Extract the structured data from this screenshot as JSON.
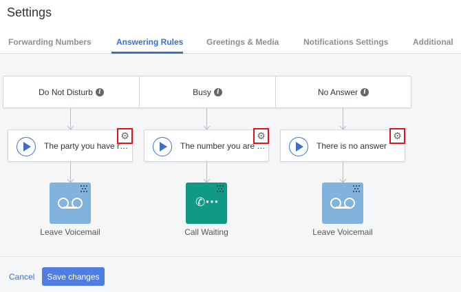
{
  "page": {
    "title": "Settings"
  },
  "tabs": [
    {
      "label": "Forwarding Numbers",
      "active": false
    },
    {
      "label": "Answering Rules",
      "active": true
    },
    {
      "label": "Greetings & Media",
      "active": false
    },
    {
      "label": "Notifications Settings",
      "active": false
    },
    {
      "label": "Additional",
      "active": false
    }
  ],
  "rules": [
    {
      "condition": "Do Not Disturb",
      "greeting": "The party you have reached is not available",
      "action": "Leave Voicemail",
      "action_icon": "voicemail-icon"
    },
    {
      "condition": "Busy",
      "greeting": "The number you are calling is busy",
      "action": "Call Waiting",
      "action_icon": "call-waiting-icon"
    },
    {
      "condition": "No Answer",
      "greeting": "There is no answer",
      "action": "Leave Voicemail",
      "action_icon": "voicemail-icon"
    }
  ],
  "footer": {
    "cancel_label": "Cancel",
    "save_label": "Save changes"
  },
  "colors": {
    "accent": "#3d6fc8",
    "save_button": "#4f7ee0",
    "voicemail_tile": "#82b3dc",
    "call_waiting_tile": "#0e9a84",
    "highlight_box": "#e3101b"
  }
}
